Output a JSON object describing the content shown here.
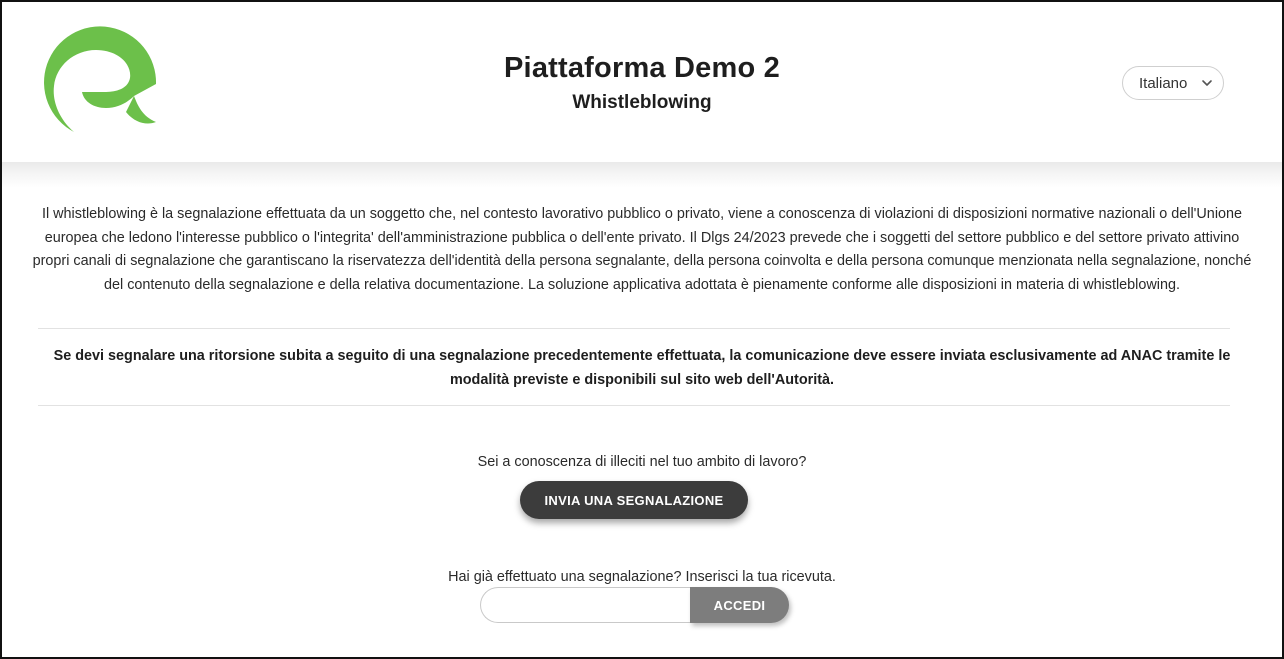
{
  "header": {
    "title": "Piattaforma Demo 2",
    "subtitle": "Whistleblowing",
    "logo_icon": "green-e-logo-icon",
    "brand_color": "#6cc04a"
  },
  "language_select": {
    "selected": "Italiano",
    "icon": "chevron-down-icon"
  },
  "intro": {
    "text": "Il whistleblowing è la segnalazione effettuata da un soggetto che, nel contesto lavorativo pubblico o privato, viene a conoscenza di violazioni di disposizioni normative nazionali o dell'Unione europea che ledono l'interesse pubblico o l'integrita' dell'amministrazione pubblica o dell'ente privato. Il Dlgs 24/2023 prevede che i soggetti del settore pubblico e del settore privato attivino propri canali di segnalazione che garantiscano la riservatezza dell'identità della persona segnalante, della persona coinvolta e della persona comunque menzionata nella segnalazione, nonché del contenuto della segnalazione e della relativa documentazione. La soluzione applicativa adottata è pienamente conforme alle disposizioni in materia di whistleblowing."
  },
  "warning": {
    "text": "Se devi segnalare una ritorsione subita a seguito di una segnalazione precedentemente effettuata, la comunicazione deve essere inviata esclusivamente ad ANAC tramite le modalità previste e disponibili sul sito web dell'Autorità."
  },
  "report": {
    "question": "Sei a conoscenza di illeciti nel tuo ambito di lavoro?",
    "button_label": "INVIA UNA SEGNALAZIONE",
    "button_color": "#3c3c3c"
  },
  "receipt": {
    "prompt": "Hai già effettuato una segnalazione? Inserisci la tua ricevuta.",
    "input_value": "",
    "button_label": "ACCEDI",
    "button_color": "#7d7d7d"
  }
}
